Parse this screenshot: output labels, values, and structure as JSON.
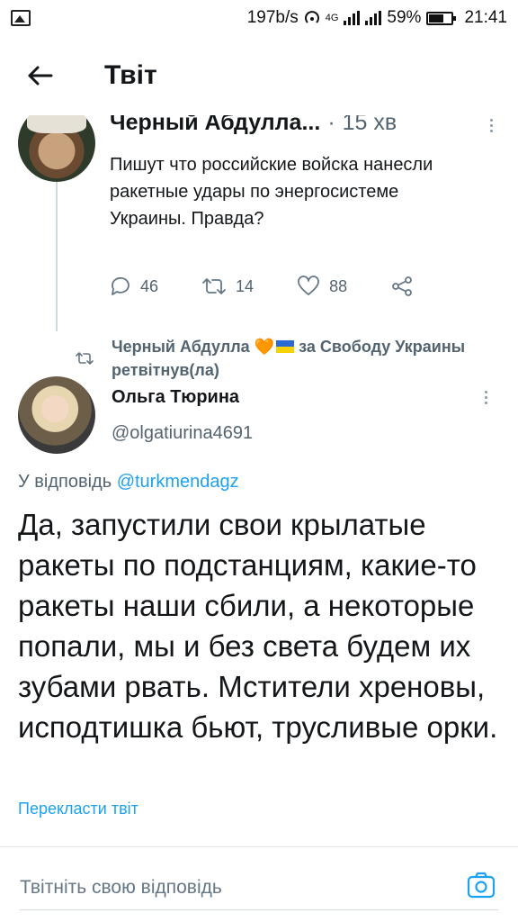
{
  "status_bar": {
    "net_speed": "197b/s",
    "network": "4G",
    "battery": "59%",
    "time": "21:41"
  },
  "header": {
    "title": "Твіт"
  },
  "parent_tweet": {
    "name": "Черный Абдулла...",
    "separator": "·",
    "time": "15 хв",
    "text": "Пишут что российские войска нанесли ракетные удары по энергосистеме Украины. Правда?",
    "replies": "46",
    "retweets": "14",
    "likes": "88"
  },
  "retweet_context": {
    "user": "Черный Абдулла",
    "heart": "🧡",
    "slogan": "за Свободу Украины",
    "action": "ретвітнув(ла)"
  },
  "reply": {
    "name": "Ольга Тюрина",
    "handle": "@olgatiurina4691",
    "reply_to_label": "У відповідь",
    "reply_to_handle": "@turkmendagz",
    "text": "Да, запустили свои крылатые ракеты по подстанциям, какие-то ракеты наши сбили, а некоторые попали, мы и без света будем их зубами рвать. Мстители хреновы, исподтишка бьют, трусливые орки.",
    "translate_label": "Перекласти твіт"
  },
  "composer": {
    "placeholder": "Твітніть свою відповідь"
  },
  "colors": {
    "link": "#1da1f2",
    "secondary_text": "#536471",
    "primary_text": "#14171a"
  }
}
